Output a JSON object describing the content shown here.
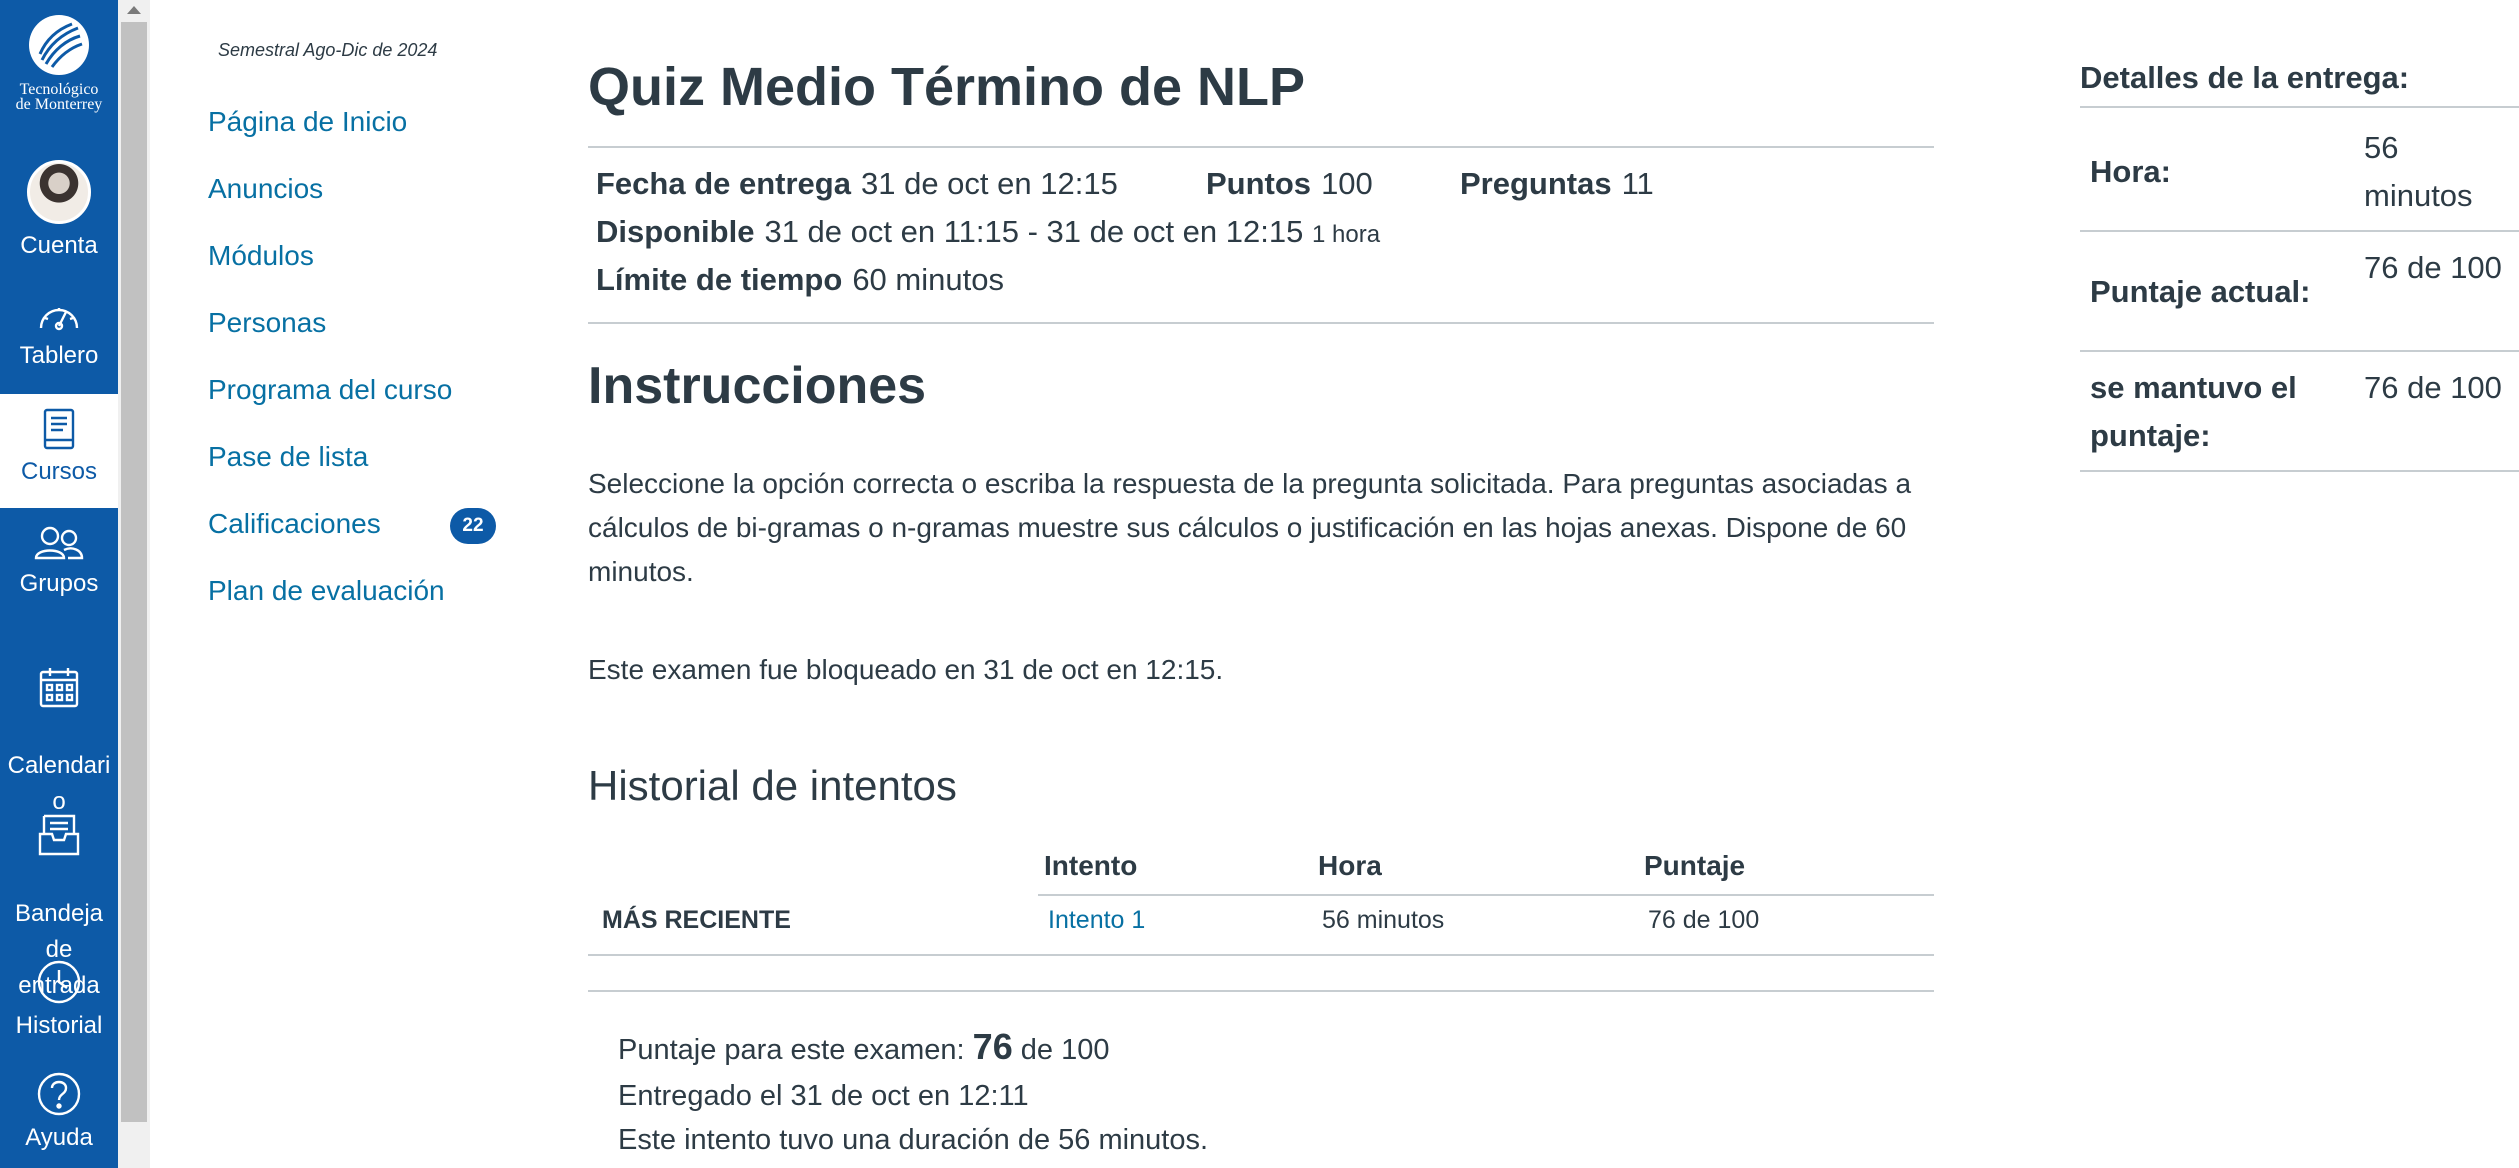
{
  "global_nav": {
    "logo_line1": "Tecnológico",
    "logo_line2": "de Monterrey",
    "items": [
      {
        "label": "Cuenta",
        "icon": "avatar"
      },
      {
        "label": "Tablero",
        "icon": "dashboard-icon"
      },
      {
        "label": "Cursos",
        "icon": "courses-icon"
      },
      {
        "label": "Grupos",
        "icon": "groups-icon"
      },
      {
        "label": "Calendari\no",
        "icon": "calendar-icon"
      },
      {
        "label": "Bandeja\nde\nentrada",
        "icon": "inbox-icon"
      },
      {
        "label": "Historial",
        "icon": "history-icon"
      },
      {
        "label": "Ayuda",
        "icon": "help-icon"
      }
    ],
    "colors": {
      "background": "#0d5aa7",
      "active_bg": "#ffffff"
    }
  },
  "course_nav": {
    "term": "Semestral Ago-Dic de 2024",
    "links": [
      "Página de Inicio",
      "Anuncios",
      "Módulos",
      "Personas",
      "Programa del curso",
      "Pase de lista",
      "Calificaciones",
      "Plan de evaluación"
    ],
    "grades_badge": "22",
    "link_color": "#0770a3"
  },
  "quiz": {
    "title": "Quiz Medio Término de NLP",
    "due_label": "Fecha de entrega",
    "due_value": "31 de oct en 12:15",
    "points_label": "Puntos",
    "points_value": "100",
    "questions_label": "Preguntas",
    "questions_value": "11",
    "available_label": "Disponible",
    "available_value": "31 de oct en 11:15 - 31 de oct en 12:15",
    "available_duration": "1 hora",
    "time_limit_label": "Límite de tiempo",
    "time_limit_value": "60 minutos",
    "instructions_heading": "Instrucciones",
    "instructions_text": "Seleccione la opción correcta o escriba la respuesta de la pregunta solicitada. Para preguntas asociadas a cálculos de bi-gramas o n-gramas muestre sus cálculos o justificación en las hojas anexas. Dispone de 60 minutos.",
    "locked_text": "Este examen fue bloqueado en 31 de oct en 12:15."
  },
  "history": {
    "heading": "Historial de intentos",
    "columns": [
      "Intento",
      "Hora",
      "Puntaje"
    ],
    "rows": [
      {
        "tag": "MÁS RECIENTE",
        "attempt": "Intento 1",
        "time": "56 minutos",
        "score": "76 de 100"
      }
    ]
  },
  "summary": {
    "score_prefix": "Puntaje para este examen: ",
    "score_value": "76",
    "score_suffix": " de 100",
    "submitted": "Entregado el 31 de oct en 12:11",
    "duration": "Este intento tuvo una duración de 56 minutos."
  },
  "details": {
    "title": "Detalles de la entrega:",
    "rows": [
      {
        "label": "Hora:",
        "value": "56 minutos"
      },
      {
        "label": "Puntaje actual:",
        "value": "76 de 100"
      },
      {
        "label": "se mantuvo el puntaje:",
        "value": "76 de 100"
      }
    ]
  }
}
